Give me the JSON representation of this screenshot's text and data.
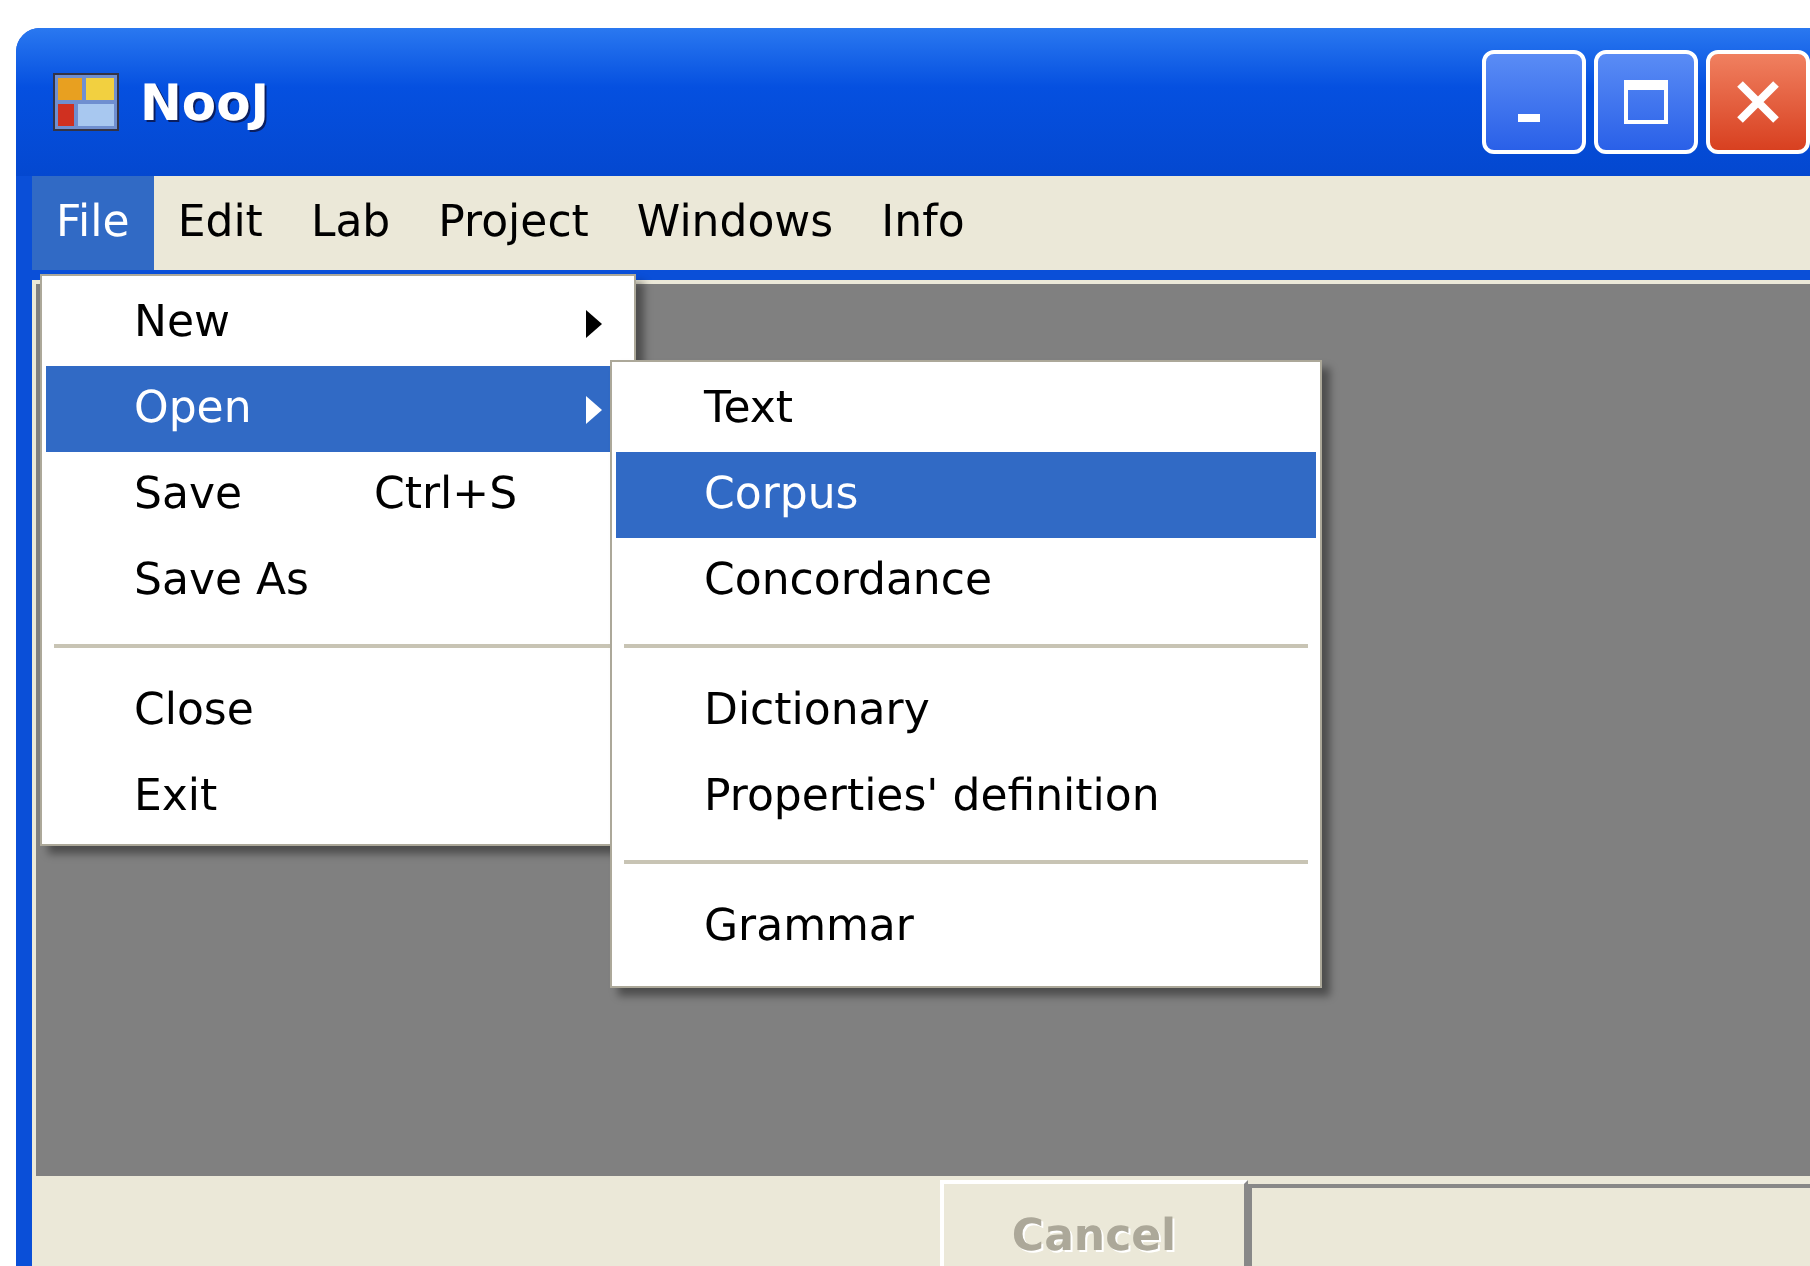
{
  "window": {
    "title": "NooJ"
  },
  "menu_bar": [
    {
      "label": "File",
      "selected": true
    },
    {
      "label": "Edit",
      "selected": false
    },
    {
      "label": "Lab",
      "selected": false
    },
    {
      "label": "Project",
      "selected": false
    },
    {
      "label": "Windows",
      "selected": false
    },
    {
      "label": "Info",
      "selected": false
    }
  ],
  "file_menu": [
    {
      "kind": "item",
      "label": "New",
      "submenu": true,
      "selected": false
    },
    {
      "kind": "item",
      "label": "Open",
      "submenu": true,
      "selected": true
    },
    {
      "kind": "item",
      "label": "Save",
      "shortcut": "Ctrl+S",
      "submenu": false,
      "selected": false
    },
    {
      "kind": "item",
      "label": "Save As",
      "submenu": false,
      "selected": false
    },
    {
      "kind": "separator"
    },
    {
      "kind": "item",
      "label": "Close",
      "submenu": false,
      "selected": false
    },
    {
      "kind": "item",
      "label": "Exit",
      "submenu": false,
      "selected": false
    }
  ],
  "open_submenu": [
    {
      "kind": "item",
      "label": "Text",
      "selected": false
    },
    {
      "kind": "item",
      "label": "Corpus",
      "selected": true
    },
    {
      "kind": "item",
      "label": "Concordance",
      "selected": false
    },
    {
      "kind": "separator"
    },
    {
      "kind": "item",
      "label": "Dictionary",
      "selected": false
    },
    {
      "kind": "item",
      "label": "Properties' definition",
      "selected": false
    },
    {
      "kind": "separator"
    },
    {
      "kind": "item",
      "label": "Grammar",
      "selected": false
    }
  ],
  "bottom_bar": {
    "button": {
      "label": "Cancel",
      "disabled": true
    }
  }
}
